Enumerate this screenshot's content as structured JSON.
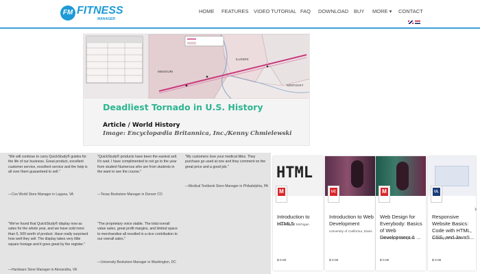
{
  "brand": {
    "badge": "FM",
    "name": "FITNESS",
    "sub": "MANAGER"
  },
  "nav": [
    {
      "label": "HOME"
    },
    {
      "label": "FEATURES"
    },
    {
      "label": "VIDEO TUTORIAL"
    },
    {
      "label": "FAQ"
    },
    {
      "label": "DOWNLOAD"
    },
    {
      "label": "BUY"
    },
    {
      "label": "MORE ▾"
    },
    {
      "label": "CONTACT"
    }
  ],
  "hero": {
    "map_labels": [
      "ILLINOIS",
      "MISSOURI",
      "KENTUCKY"
    ],
    "title": "Deadliest Tornado in U.S. History",
    "subtitle": "Article / World History",
    "credit": "Image: Encyclopædia Britannica, Inc./Kenny Chmielewski"
  },
  "testimonials": [
    {
      "text": "\"We will continue to carry QuickStudy® guides for the life of our business. Great product, excellent customer service, excellent service and the help is all over them guaranteed to sell.\"",
      "sig": "—Cox World Store Manager in Laguna, VA"
    },
    {
      "text": "\"QuickStudy® products have been the easiest sell. It's wait. I have complimented to not go to the year from student Numerous who are from students in the want to see the course.\"",
      "sig": "—Texas Bookstore Manager in Denver CO"
    },
    {
      "text": "\"My customers love your medical titles. They purchase go used at one and they comment on the great price and a good job.\"",
      "sig": "—Medical Textbook Store Manager in Philadelphia, PA"
    },
    {
      "text": "\"We've found that QuickStudy® display now as sales for the whole year, and we have sold more than 5, 500 worth of product. Have really surprised how well they sell. The display takes very little square footage and it goes great by the register.\"",
      "sig": "—Hardware Store Manager in Alexandria, VA"
    },
    {
      "text": "\"The proprietary voice stable. The total overall value sales, great profit margins, and limited space to merchandise all resulted in a nice contribution to our overall sales.\"",
      "sig": "—University Bookstore Manager in Washington, DC"
    }
  ],
  "courses": [
    {
      "title": "Introduction to HTML5",
      "author": "University of Michigan",
      "price": "$ 0.00"
    },
    {
      "title": "Introduction to Web Development",
      "author": "University of California, Davis",
      "price": "$ 0.00"
    },
    {
      "title": "Web Design for Everybody: Basics of Web Development & ...",
      "author": "University of Michigan",
      "price": "$ 0.00"
    },
    {
      "title": "Responsive Website Basics: Code with HTML, CSS, and JavaS...",
      "author": "University of London",
      "price": "$ 0.00"
    }
  ],
  "thumb_text": "HTML",
  "colors": {
    "accent": "#1e9ad6",
    "hero_title": "#2bb58f",
    "badge_red": "#d8272b"
  }
}
